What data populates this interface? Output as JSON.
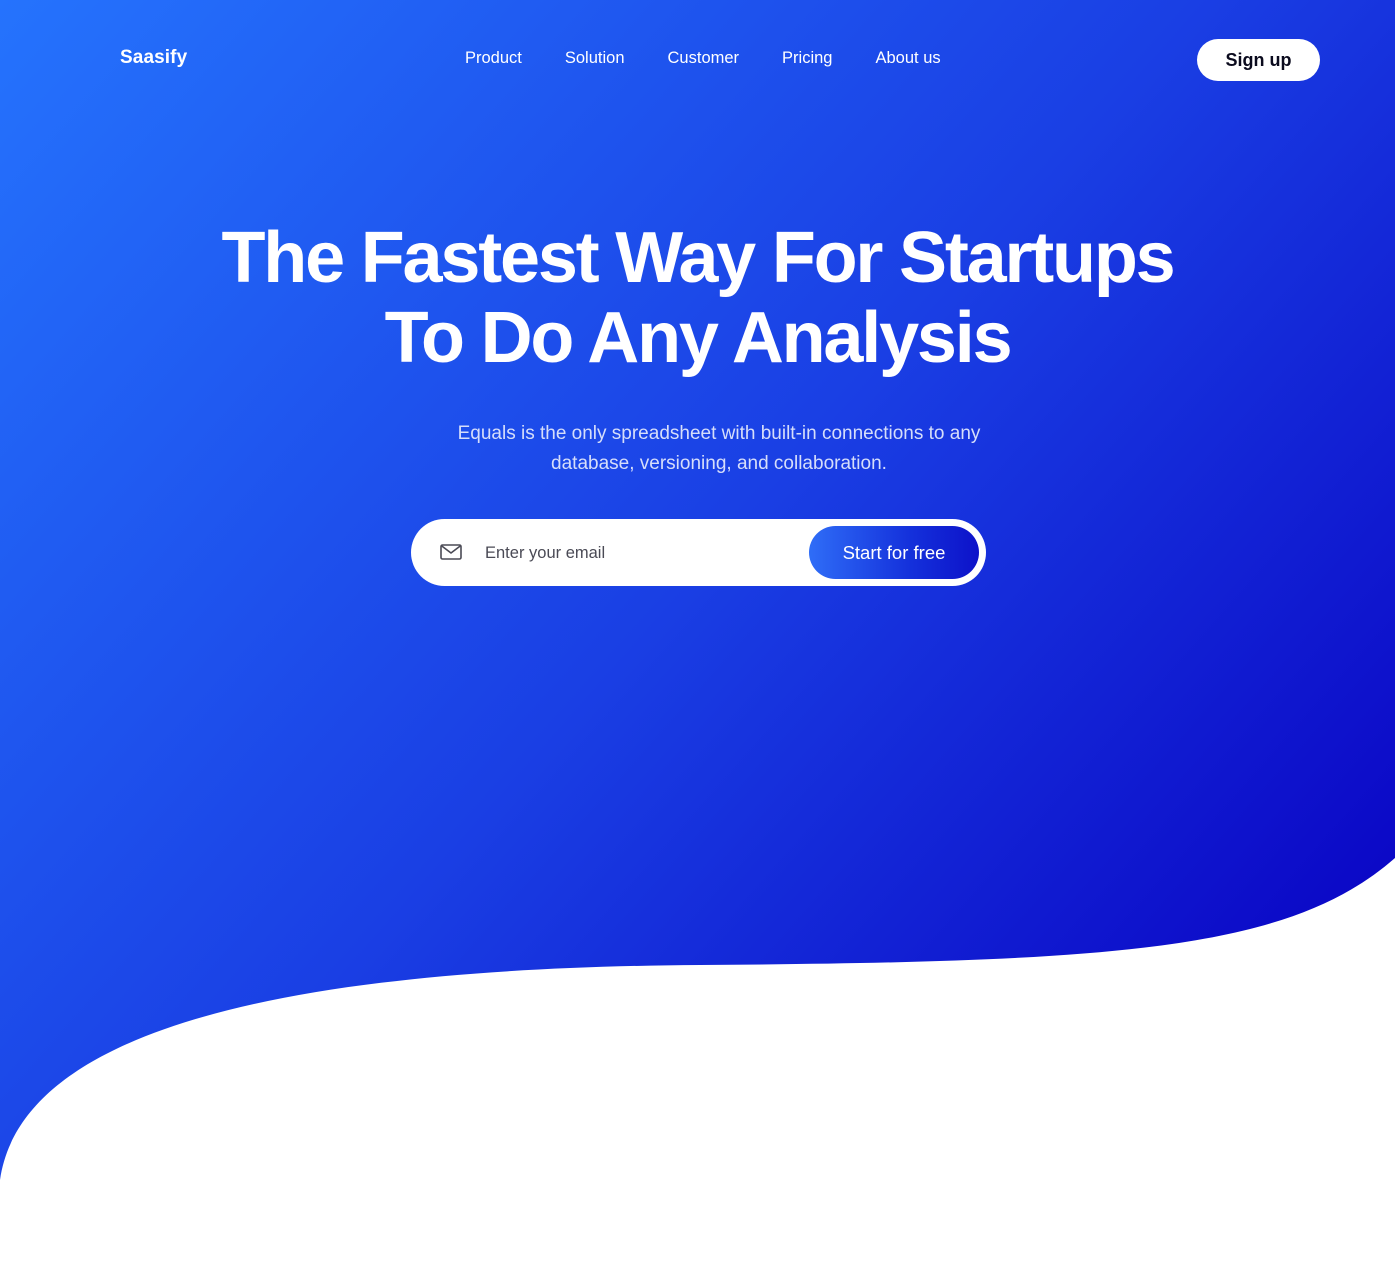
{
  "brand": {
    "name": "Saasify"
  },
  "nav": {
    "links": [
      {
        "label": "Product"
      },
      {
        "label": "Solution"
      },
      {
        "label": "Customer"
      },
      {
        "label": "Pricing"
      },
      {
        "label": "About us"
      }
    ],
    "signup_label": "Sign up"
  },
  "hero": {
    "headline_line1": "The Fastest Way For Startups",
    "headline_line2": "To Do Any Analysis",
    "subtitle_line1": "Equals is the only spreadsheet with built-in connections to any",
    "subtitle_line2": "database, versioning, and collaboration.",
    "email_placeholder": "Enter your email",
    "cta_label": "Start for free"
  },
  "colors": {
    "gradient_start": "#2573fd",
    "gradient_end": "#0b07c6",
    "background": "#ffffff",
    "subtitle_text": "#d6defa"
  },
  "icons": {
    "email": "mail-icon"
  }
}
